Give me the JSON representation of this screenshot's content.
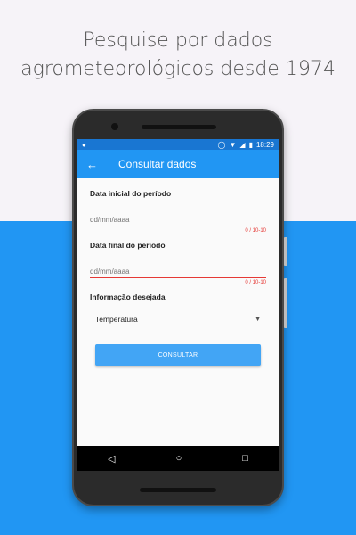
{
  "headline_line1": "Pesquise por dados",
  "headline_line2": "agrometeorológicos desde 1974",
  "status_bar": {
    "time": "18:29",
    "notification_icon": "android-icon"
  },
  "app_bar": {
    "back_icon": "arrow-back-icon",
    "title": "Consultar dados"
  },
  "form": {
    "start_date_label": "Data inicial do período",
    "start_date_placeholder": "dd/mm/aaaa",
    "start_date_counter": "0 / 10-10",
    "end_date_label": "Data final do período",
    "end_date_placeholder": "dd/mm/aaaa",
    "end_date_counter": "0 / 10-10",
    "info_label": "Informação desejada",
    "info_selected": "Temperatura",
    "submit_label": "CONSULTAR"
  },
  "nav_bar": {
    "back": "◁",
    "home": "○",
    "recents": "□"
  },
  "colors": {
    "primary": "#2196f3",
    "primary_dark": "#1976d2",
    "error": "#e53935",
    "button": "#42a5f5"
  }
}
